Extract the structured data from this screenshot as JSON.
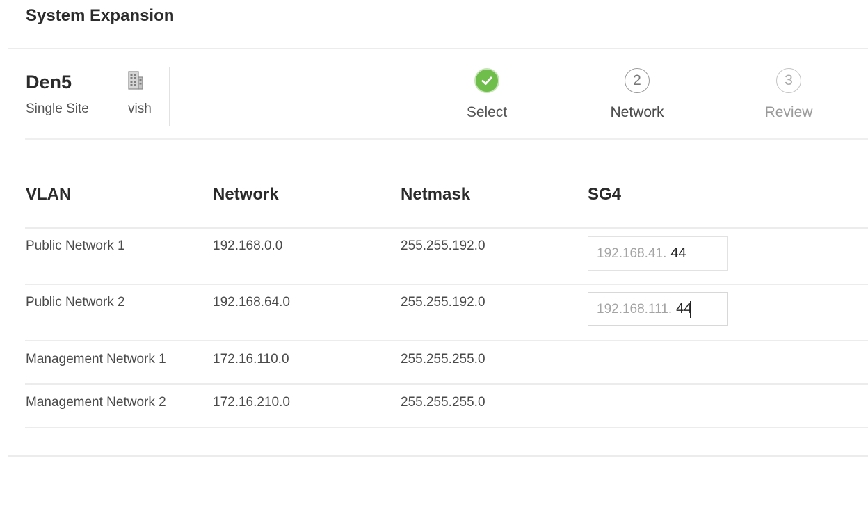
{
  "header": {
    "title": "System Expansion"
  },
  "site": {
    "name": "Den5",
    "type": "Single Site",
    "owner_icon": "building-icon",
    "owner": "vish"
  },
  "steps": [
    {
      "number": "",
      "label": "Select",
      "state": "done",
      "icon": "check-icon"
    },
    {
      "number": "2",
      "label": "Network",
      "state": "current"
    },
    {
      "number": "3",
      "label": "Review",
      "state": "future"
    }
  ],
  "table": {
    "headers": {
      "vlan": "VLAN",
      "network": "Network",
      "netmask": "Netmask",
      "sg": "SG4"
    },
    "rows": [
      {
        "vlan": "Public Network 1",
        "network": "192.168.0.0",
        "netmask": "255.255.192.0",
        "sg_prefix": "192.168.41.",
        "sg_value": "44"
      },
      {
        "vlan": "Public Network 2",
        "network": "192.168.64.0",
        "netmask": "255.255.192.0",
        "sg_prefix": "192.168.111.",
        "sg_value": "44"
      },
      {
        "vlan": "Management Network 1",
        "network": "172.16.110.0",
        "netmask": "255.255.255.0"
      },
      {
        "vlan": "Management Network 2",
        "network": "172.16.210.0",
        "netmask": "255.255.255.0"
      }
    ]
  },
  "colors": {
    "success": "#6fbd4a",
    "rule": "#ececec"
  }
}
